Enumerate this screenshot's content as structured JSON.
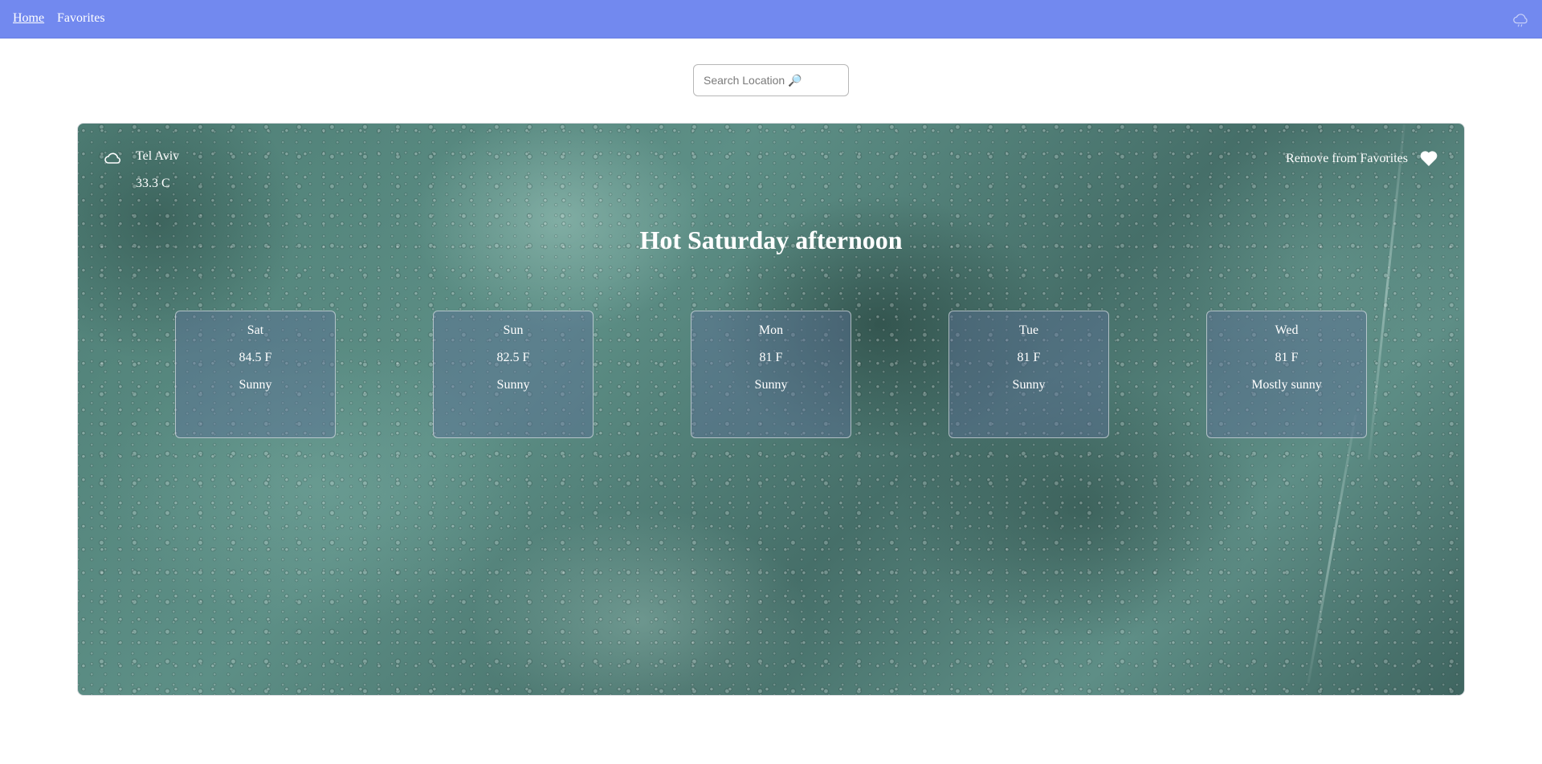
{
  "nav": {
    "home_label": "Home",
    "favorites_label": "Favorites",
    "theme_icon": "cloud-toggle-icon"
  },
  "search": {
    "placeholder": "Search Location 🔎",
    "value": ""
  },
  "current": {
    "location": "Tel Aviv",
    "temperature": "33.3 C",
    "weather_icon": "cloud-icon",
    "favorite_action_label": "Remove from Favorites",
    "favorite_icon": "heart-icon",
    "headline": "Hot Saturday afternoon"
  },
  "forecast": [
    {
      "day": "Sat",
      "temp": "84.5 F",
      "condition": "Sunny"
    },
    {
      "day": "Sun",
      "temp": "82.5 F",
      "condition": "Sunny"
    },
    {
      "day": "Mon",
      "temp": "81 F",
      "condition": "Sunny"
    },
    {
      "day": "Tue",
      "temp": "81 F",
      "condition": "Sunny"
    },
    {
      "day": "Wed",
      "temp": "81 F",
      "condition": "Mostly sunny"
    }
  ],
  "colors": {
    "navbar": "#7289ef",
    "card_text": "#ffffff"
  }
}
